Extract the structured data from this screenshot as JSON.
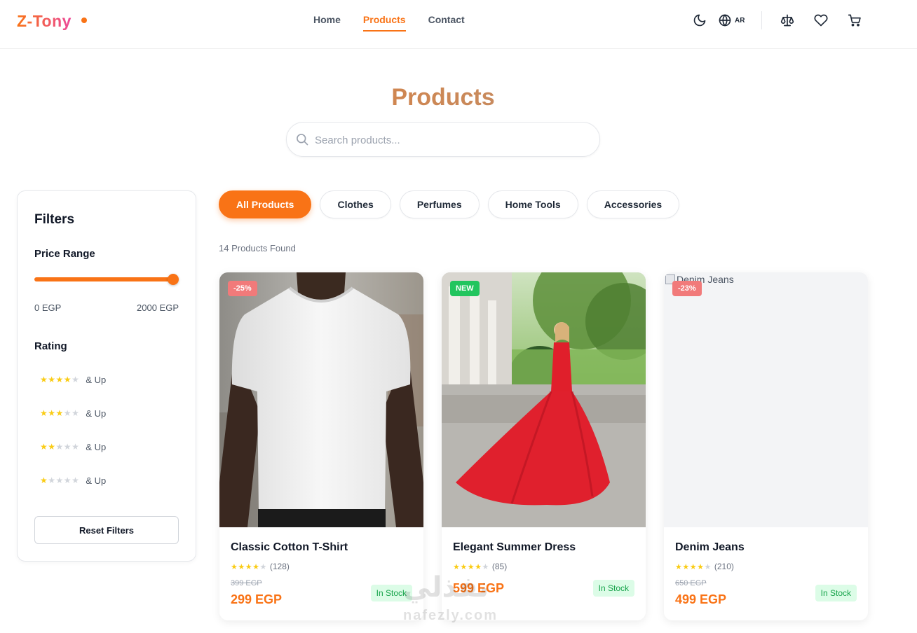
{
  "header": {
    "logo": "Z-Tony",
    "nav": [
      {
        "label": "Home",
        "active": false
      },
      {
        "label": "Products",
        "active": true
      },
      {
        "label": "Contact",
        "active": false
      }
    ],
    "language_label": "AR",
    "icons": [
      "moon-icon",
      "globe-icon",
      "scale-icon",
      "heart-icon",
      "cart-icon"
    ]
  },
  "hero": {
    "title": "Products",
    "search_placeholder": "Search products..."
  },
  "filters": {
    "title": "Filters",
    "price_range": {
      "title": "Price Range",
      "min_label": "0 EGP",
      "max_label": "2000 EGP",
      "value": 2000,
      "max": 2000
    },
    "rating": {
      "title": "Rating",
      "options": [
        {
          "stars": 4,
          "label": "& Up"
        },
        {
          "stars": 3,
          "label": "& Up"
        },
        {
          "stars": 2,
          "label": "& Up"
        },
        {
          "stars": 1,
          "label": "& Up"
        }
      ]
    },
    "reset_label": "Reset Filters"
  },
  "categories": [
    {
      "label": "All Products",
      "active": true
    },
    {
      "label": "Clothes",
      "active": false
    },
    {
      "label": "Perfumes",
      "active": false
    },
    {
      "label": "Home Tools",
      "active": false
    },
    {
      "label": "Accessories",
      "active": false
    }
  ],
  "results_count": "14 Products Found",
  "products": [
    {
      "name": "Classic Cotton T-Shirt",
      "badge": "-25%",
      "badge_type": "sale",
      "rating": 4,
      "reviews": "(128)",
      "old_price": "399 EGP",
      "price": "299 EGP",
      "stock": "In Stock",
      "image": "white-tshirt-photo"
    },
    {
      "name": "Elegant Summer Dress",
      "badge": "NEW",
      "badge_type": "new",
      "rating": 4,
      "reviews": "(85)",
      "old_price": "",
      "price": "599 EGP",
      "stock": "In Stock",
      "image": "red-dress-photo"
    },
    {
      "name": "Denim Jeans",
      "badge": "-23%",
      "badge_type": "sale",
      "rating": 4,
      "reviews": "(210)",
      "old_price": "650 EGP",
      "price": "499 EGP",
      "stock": "In Stock",
      "image_alt": "Denim Jeans"
    }
  ],
  "watermark": {
    "arabic": "نفذلي",
    "latin": "nafezly.com"
  },
  "colors": {
    "accent": "#f97316",
    "star": "#facc15",
    "sale_badge": "#f17a7a",
    "new_badge": "#22c55e",
    "stock_bg": "#dcfce7",
    "stock_text": "#16a34a"
  }
}
